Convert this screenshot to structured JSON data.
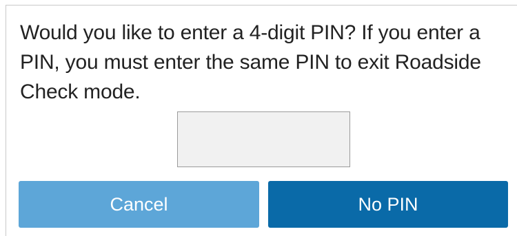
{
  "dialog": {
    "message": "Would you like to enter a 4-digit PIN? If you enter a PIN, you must enter the same PIN to exit Roadside Check mode.",
    "pin_value": "",
    "pin_placeholder": "",
    "cancel_label": "Cancel",
    "no_pin_label": "No PIN"
  },
  "colors": {
    "cancel_button": "#5da6d8",
    "no_pin_button": "#0a6aa8",
    "input_background": "#f1f1f1"
  }
}
